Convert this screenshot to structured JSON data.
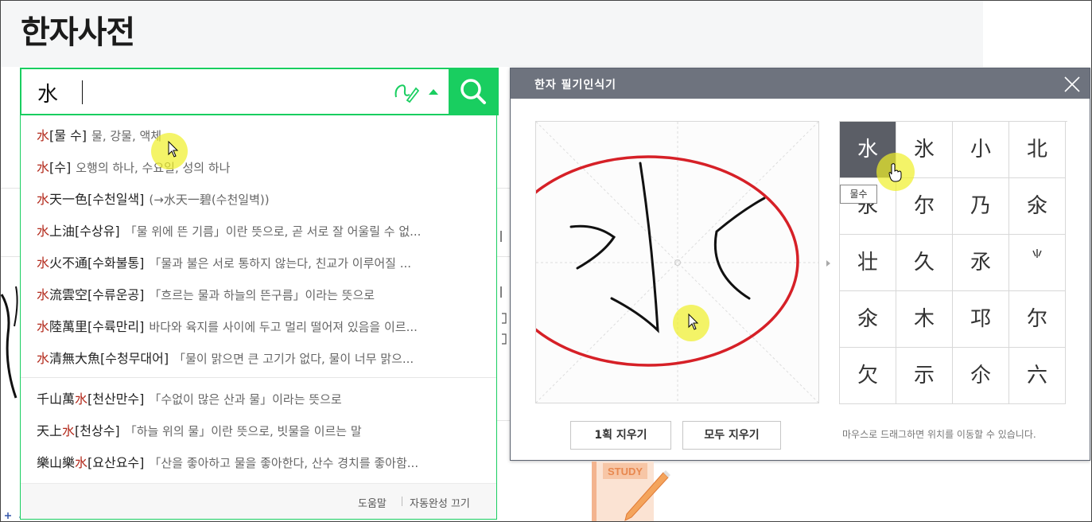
{
  "page": {
    "title": "한자사전"
  },
  "search": {
    "value": "水",
    "placeholder": ""
  },
  "autocomplete": {
    "items": [
      {
        "hanja_pre": "",
        "hanja_hl": "水",
        "hanja_post": "",
        "reading": "[물 수]",
        "desc": "물, 강물, 액체"
      },
      {
        "hanja_pre": "",
        "hanja_hl": "水",
        "hanja_post": "",
        "reading": "[수]",
        "desc": "오행의 하나, 수요일, 성의 하나"
      },
      {
        "hanja_pre": "",
        "hanja_hl": "水",
        "hanja_post": "天一色",
        "reading": "[수천일색]",
        "desc": "(→水天一碧(수천일벽))"
      },
      {
        "hanja_pre": "",
        "hanja_hl": "水",
        "hanja_post": "上油",
        "reading": "[수상유]",
        "desc": "「물 위에 뜬 기름」이란 뜻으로, 곧 서로 잘 어울릴 수 없..."
      },
      {
        "hanja_pre": "",
        "hanja_hl": "水",
        "hanja_post": "火不通",
        "reading": "[수화불통]",
        "desc": "「물과 불은 서로 통하지 않는다, 친교가 이루어질 ..."
      },
      {
        "hanja_pre": "",
        "hanja_hl": "水",
        "hanja_post": "流雲空",
        "reading": "[수류운공]",
        "desc": "「흐르는 물과 하늘의 뜬구름」이라는 뜻으로"
      },
      {
        "hanja_pre": "",
        "hanja_hl": "水",
        "hanja_post": "陸萬里",
        "reading": "[수륙만리]",
        "desc": "바다와 육지를 사이에 두고 멀리 떨어져 있음을 이르..."
      },
      {
        "hanja_pre": "",
        "hanja_hl": "水",
        "hanja_post": "清無大魚",
        "reading": "[수청무대어]",
        "desc": "「물이 맑으면 큰 고기가 없다, 물이 너무 맑으..."
      },
      {
        "hanja_pre": "千山萬",
        "hanja_hl": "水",
        "hanja_post": "",
        "reading": "[천산만수]",
        "desc": "「수없이 많은 산과 물」이라는 뜻으로"
      },
      {
        "hanja_pre": "天上",
        "hanja_hl": "水",
        "hanja_post": "",
        "reading": "[천상수]",
        "desc": "「하늘 위의 물」이란 뜻으로, 빗물을 이르는 말"
      },
      {
        "hanja_pre": "樂山樂",
        "hanja_hl": "水",
        "hanja_post": "",
        "reading": "[요산요수]",
        "desc": "「산을 좋아하고 물을 좋아한다, 산수 경치를 좋아함..."
      }
    ],
    "footer": {
      "help": "도움말",
      "autocomplete_off": "자동완성 끄기"
    }
  },
  "handwriting": {
    "title": "한자 필기인식기",
    "candidates": [
      "水",
      "氷",
      "小",
      "北",
      "永",
      "尔",
      "乃",
      "氽",
      "壮",
      "久",
      "氶",
      "",
      "氽",
      "木",
      "邛",
      "尔",
      "欠",
      "示",
      "尒",
      "六"
    ],
    "tooltip": "물수",
    "erase_stroke_label": "1획 지우기",
    "erase_all_label": "모두 지우기",
    "hint": "마우스로 드래그하면 위치를 이동할 수 있습니다.",
    "accent_color": "#d62027"
  },
  "study": {
    "label": "STUDY"
  },
  "colors": {
    "brand": "#19ce60",
    "highlight": "#b3291b",
    "panel_header": "#6e737e"
  }
}
